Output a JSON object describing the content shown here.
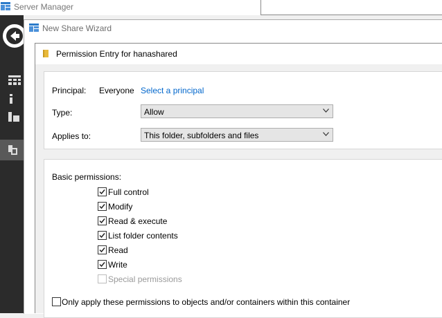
{
  "server_manager": {
    "title": "Server Manager"
  },
  "wizard": {
    "title": "New Share Wizard"
  },
  "dialog": {
    "title": "Permission Entry for hanashared",
    "principal_label": "Principal:",
    "principal_value": "Everyone",
    "select_principal_link": "Select a principal",
    "type_label": "Type:",
    "type_value": "Allow",
    "applies_label": "Applies to:",
    "applies_value": "This folder, subfolders and files",
    "basic_permissions_label": "Basic permissions:",
    "permissions": [
      {
        "label": "Full control",
        "checked": true,
        "enabled": true
      },
      {
        "label": "Modify",
        "checked": true,
        "enabled": true
      },
      {
        "label": "Read & execute",
        "checked": true,
        "enabled": true
      },
      {
        "label": "List folder contents",
        "checked": true,
        "enabled": true
      },
      {
        "label": "Read",
        "checked": true,
        "enabled": true
      },
      {
        "label": "Write",
        "checked": true,
        "enabled": true
      },
      {
        "label": "Special permissions",
        "checked": false,
        "enabled": false
      }
    ],
    "only_apply_label": "Only apply these permissions to objects and/or containers within this container",
    "only_apply_checked": false
  }
}
